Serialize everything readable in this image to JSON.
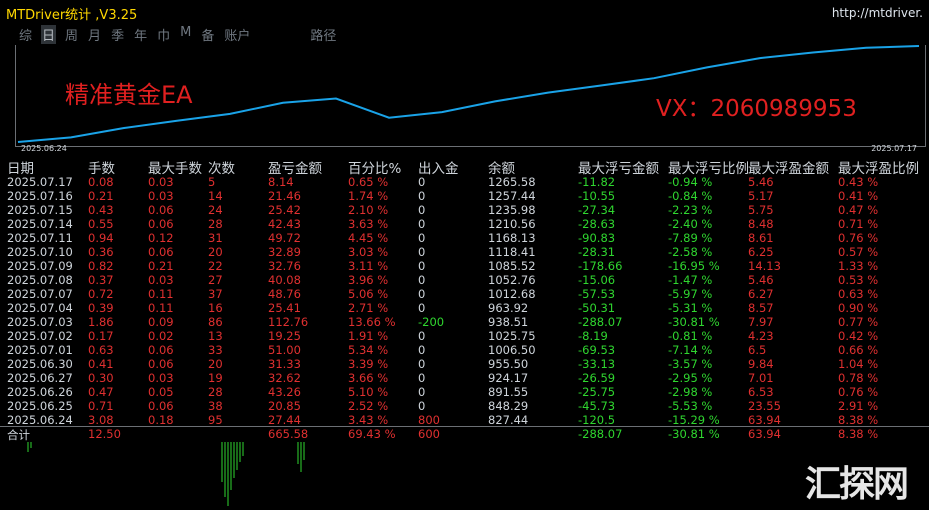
{
  "window": {
    "title": "MTDriver统计 ,V3.25",
    "url": "http://mtdriver."
  },
  "tabs": [
    "综",
    "日",
    "周",
    "月",
    "季",
    "年",
    "巾",
    "M",
    "备",
    "账户",
    "路径"
  ],
  "active_tab": "日",
  "chart": {
    "overlay_left": "精准黄金EA",
    "overlay_right": "VX：2060989953",
    "x_start_label": "2025.06.24",
    "x_end_label": "2025.07.17",
    "line_color": "#1aa3e8"
  },
  "chart_data": {
    "type": "line",
    "x": [
      "2025.06.24",
      "2025.06.25",
      "2025.06.26",
      "2025.06.27",
      "2025.06.30",
      "2025.07.01",
      "2025.07.02",
      "2025.07.03",
      "2025.07.04",
      "2025.07.07",
      "2025.07.08",
      "2025.07.09",
      "2025.07.10",
      "2025.07.11",
      "2025.07.14",
      "2025.07.15",
      "2025.07.16",
      "2025.07.17"
    ],
    "series": [
      {
        "values": [
          827.44,
          848.29,
          891.55,
          924.17,
          955.5,
          1006.5,
          1025.75,
          938.51,
          963.92,
          1012.68,
          1052.76,
          1085.52,
          1118.41,
          1168.13,
          1210.56,
          1235.98,
          1257.44,
          1265.58
        ]
      }
    ]
  },
  "table": {
    "headers": [
      "日期",
      "手数",
      "最大手数",
      "次数",
      "盈亏金额",
      "百分比%",
      "出入金",
      "余额",
      "最大浮亏金额",
      "最大浮亏比例",
      "最大浮盈金额",
      "最大浮盈比例"
    ],
    "rows": [
      [
        "2025.07.17",
        "0.08",
        "0.03",
        "5",
        "8.14",
        "0.65 %",
        "0",
        "1265.58",
        "-11.82",
        "-0.94 %",
        "5.46",
        "0.43 %"
      ],
      [
        "2025.07.16",
        "0.21",
        "0.03",
        "14",
        "21.46",
        "1.74 %",
        "0",
        "1257.44",
        "-10.55",
        "-0.84 %",
        "5.17",
        "0.41 %"
      ],
      [
        "2025.07.15",
        "0.43",
        "0.06",
        "24",
        "25.42",
        "2.10 %",
        "0",
        "1235.98",
        "-27.34",
        "-2.23 %",
        "5.75",
        "0.47 %"
      ],
      [
        "2025.07.14",
        "0.55",
        "0.06",
        "28",
        "42.43",
        "3.63 %",
        "0",
        "1210.56",
        "-28.63",
        "-2.40 %",
        "8.48",
        "0.71 %"
      ],
      [
        "2025.07.11",
        "0.94",
        "0.12",
        "31",
        "49.72",
        "4.45 %",
        "0",
        "1168.13",
        "-90.83",
        "-7.89 %",
        "8.61",
        "0.76 %"
      ],
      [
        "2025.07.10",
        "0.36",
        "0.06",
        "20",
        "32.89",
        "3.03 %",
        "0",
        "1118.41",
        "-28.31",
        "-2.58 %",
        "6.25",
        "0.57 %"
      ],
      [
        "2025.07.09",
        "0.82",
        "0.21",
        "22",
        "32.76",
        "3.11 %",
        "0",
        "1085.52",
        "-178.66",
        "-16.95 %",
        "14.13",
        "1.33 %"
      ],
      [
        "2025.07.08",
        "0.37",
        "0.03",
        "27",
        "40.08",
        "3.96 %",
        "0",
        "1052.76",
        "-15.06",
        "-1.47 %",
        "5.46",
        "0.53 %"
      ],
      [
        "2025.07.07",
        "0.72",
        "0.11",
        "37",
        "48.76",
        "5.06 %",
        "0",
        "1012.68",
        "-57.53",
        "-5.97 %",
        "6.27",
        "0.63 %"
      ],
      [
        "2025.07.04",
        "0.39",
        "0.11",
        "16",
        "25.41",
        "2.71 %",
        "0",
        "963.92",
        "-50.31",
        "-5.31 %",
        "8.57",
        "0.90 %"
      ],
      [
        "2025.07.03",
        "1.86",
        "0.09",
        "86",
        "112.76",
        "13.66 %",
        "-200",
        "938.51",
        "-288.07",
        "-30.81 %",
        "7.97",
        "0.77 %"
      ],
      [
        "2025.07.02",
        "0.17",
        "0.02",
        "13",
        "19.25",
        "1.91 %",
        "0",
        "1025.75",
        "-8.19",
        "-0.81 %",
        "4.23",
        "0.42 %"
      ],
      [
        "2025.07.01",
        "0.63",
        "0.06",
        "33",
        "51.00",
        "5.34 %",
        "0",
        "1006.50",
        "-69.53",
        "-7.14 %",
        "6.5",
        "0.66 %"
      ],
      [
        "2025.06.30",
        "0.41",
        "0.06",
        "20",
        "31.33",
        "3.39 %",
        "0",
        "955.50",
        "-33.13",
        "-3.57 %",
        "9.84",
        "1.04 %"
      ],
      [
        "2025.06.27",
        "0.30",
        "0.03",
        "19",
        "32.62",
        "3.66 %",
        "0",
        "924.17",
        "-26.59",
        "-2.95 %",
        "7.01",
        "0.78 %"
      ],
      [
        "2025.06.26",
        "0.47",
        "0.05",
        "28",
        "43.26",
        "5.10 %",
        "0",
        "891.55",
        "-25.75",
        "-2.98 %",
        "6.53",
        "0.76 %"
      ],
      [
        "2025.06.25",
        "0.71",
        "0.06",
        "38",
        "20.85",
        "2.52 %",
        "0",
        "848.29",
        "-45.73",
        "-5.53 %",
        "23.55",
        "2.91 %"
      ],
      [
        "2025.06.24",
        "3.08",
        "0.18",
        "95",
        "27.44",
        "3.43 %",
        "800",
        "827.44",
        "-120.5",
        "-15.29 %",
        "63.94",
        "8.38 %"
      ]
    ],
    "total": [
      "合计",
      "12.50",
      "",
      "",
      "665.58",
      "69.43 %",
      "600",
      "",
      "-288.07",
      "-30.81 %",
      "63.94",
      "8.38 %"
    ]
  },
  "watermark": "汇探网"
}
